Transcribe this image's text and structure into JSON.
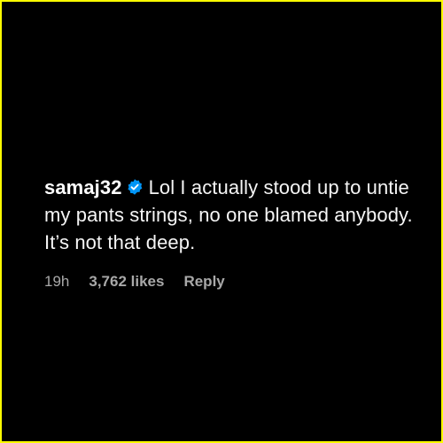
{
  "comment": {
    "username": "samaj32",
    "verified_icon": "verified-badge-icon",
    "verified_color": "#0095f6",
    "text": "Lol I actually stood up to untie my pants strings, no one blamed anybody. It’s not that deep.",
    "time": "19h",
    "likes": "3,762 likes",
    "reply": "Reply"
  },
  "colors": {
    "background": "#000000",
    "border": "#ffff00",
    "text": "#f5f5f5",
    "meta": "#a8a8a8"
  }
}
